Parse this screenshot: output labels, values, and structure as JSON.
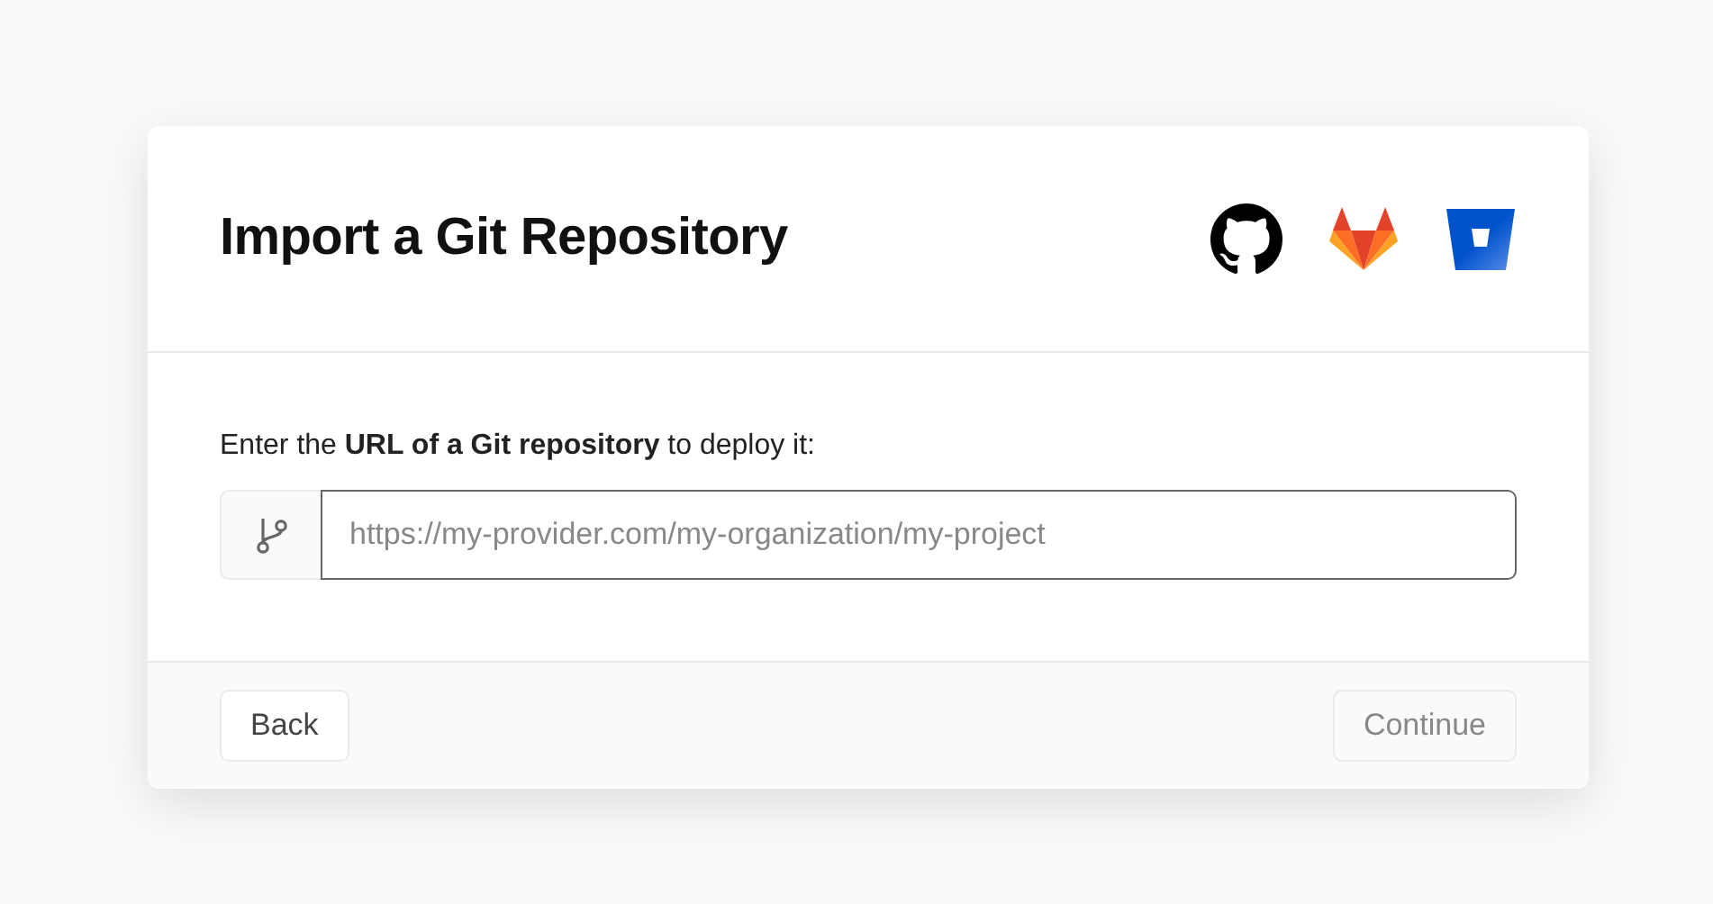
{
  "dialog": {
    "title": "Import a Git Repository",
    "providers": [
      {
        "kind": "github"
      },
      {
        "kind": "gitlab"
      },
      {
        "kind": "bitbucket"
      }
    ],
    "prompt": "Enter the **URL of a Git repository** to deploy it:",
    "url_field": {
      "placeholder": "https://my-provider.com/my-organization/my-project",
      "focused": true
    },
    "buttons": [
      {
        "label": "Back",
        "disabled": false
      },
      {
        "label": "Continue",
        "disabled": true
      }
    ]
  }
}
